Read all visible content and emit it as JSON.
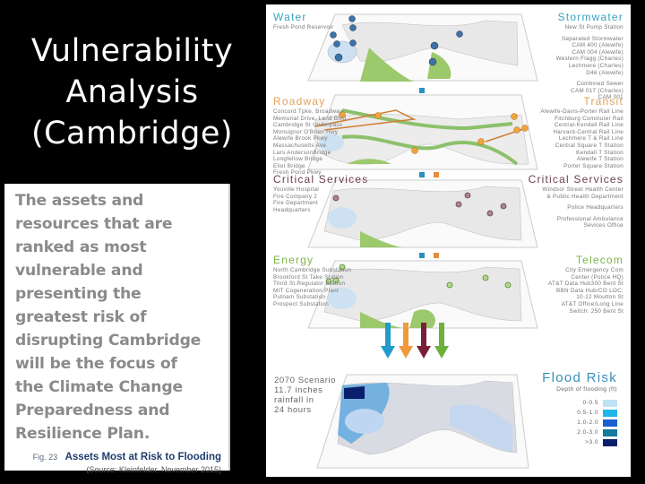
{
  "slide": {
    "title_lines": [
      "Vulnerability",
      "Analysis",
      "(Cambridge)"
    ],
    "body_lines": [
      "The assets and",
      "resources that are",
      "ranked as most",
      "vulnerable and",
      "presenting the",
      "greatest risk of",
      "disrupting Cambridge",
      "will be the focus of",
      "the Climate Change",
      "Preparedness and",
      "Resilience Plan."
    ],
    "figure": {
      "number": "Fig. 23",
      "title": "Assets Most at Risk to Flooding",
      "source": "(Source: Kleinfelder, November 2015)"
    }
  },
  "colors": {
    "water": "#3aa3bf",
    "roadway": "#e0a35a",
    "transit": "#e0a35a",
    "critical": "#6b3d52",
    "energy": "#7ab648",
    "telecom": "#7ab648",
    "flood_title": "#3a8fbc",
    "arrow_blue": "#1f9ccc",
    "arrow_orange": "#ef9a3f",
    "arrow_maroon": "#7a1f3a",
    "arrow_green": "#6bb13b"
  },
  "layers": {
    "water": {
      "heading": "Water",
      "items": [
        "Fresh Pond Reservoir"
      ]
    },
    "stormwater": {
      "heading": "Stormwater",
      "items": [
        "New St Pump Station"
      ],
      "separated": [
        "Separated Stormwater",
        "CAM 400 (Alewife)",
        "CAM 004 (Alewife)",
        "Western Flagg (Charles)",
        "Lechmere (Charles)",
        "D46 (Alewife)"
      ],
      "combined": [
        "Combined Sewer",
        "CAM 017 (Charles)",
        "CAM 001"
      ]
    },
    "roadway": {
      "heading": "Roadway",
      "items": [
        "Concord Tpke, Broadway",
        "Memorial Drive, Land Blvd",
        "Cambridge St Underpass",
        "Monsignor O'Brien Hwy",
        "Alewife Brook Pkwy",
        "Massachusetts Ave",
        "Lars AndersonBridge",
        "Longfellow Bridge",
        "Eliot Bridge",
        "Fresh Pond Pkwy"
      ]
    },
    "transit": {
      "heading": "Transit",
      "items": [
        "Alewife-Davis-Porter Rail Line",
        "Fitchburg Commuter Rail",
        "Central-Kendall Rail Line",
        "Harvard-Central Rail Line",
        "Lechmere T & Rail Line",
        "Central Square T Station",
        "Kendall T Station",
        "Alewife T Station",
        "Porter Square Station"
      ]
    },
    "critical_left": {
      "heading": "Critical Services",
      "items": [
        "Youville Hospital",
        "Fire Company 2",
        "Fire Department",
        "Headquarters"
      ]
    },
    "critical_right": {
      "heading": "Critical Services",
      "group1": [
        "Windsor Street Health Center",
        "& Public Health Department"
      ],
      "group2": [
        "Police Headquarters"
      ],
      "group3": [
        "Professional Ambulance",
        "Sevices Office"
      ]
    },
    "energy": {
      "heading": "Energy",
      "items": [
        "North Cambridge Substation",
        "Brookford St Take Station",
        "Third St.Regulator Station",
        "MIT Cogeneration Plant",
        "Putnam Substation",
        "Prospect Substation"
      ]
    },
    "telecom": {
      "heading": "Telecom",
      "items": [
        "City Emergency Com",
        "Center (Police HQ)",
        "AT&T Data Hub300 Bent St",
        "BBN Data Hub/CO LOC:",
        "10-12 Moulton St",
        "AT&T Office/Long Line",
        "Switch: 250 Bent St"
      ]
    }
  },
  "scenario": {
    "lines": [
      "2070 Scenario",
      "11.7 inches",
      "rainfall in",
      "24 hours"
    ]
  },
  "flood_legend": {
    "title": "Flood Risk",
    "subtitle": "Depth of flooding (ft)",
    "entries": [
      {
        "label": "0-0.5",
        "color": "#bfe3f5"
      },
      {
        "label": "0.5-1.0",
        "color": "#22b5e8"
      },
      {
        "label": "1.0-2.0",
        "color": "#1a5fd0"
      },
      {
        "label": "2.0-3.0",
        "color": "#137a9c"
      },
      {
        "label": ">3.0",
        "color": "#0a1f6b"
      }
    ]
  }
}
